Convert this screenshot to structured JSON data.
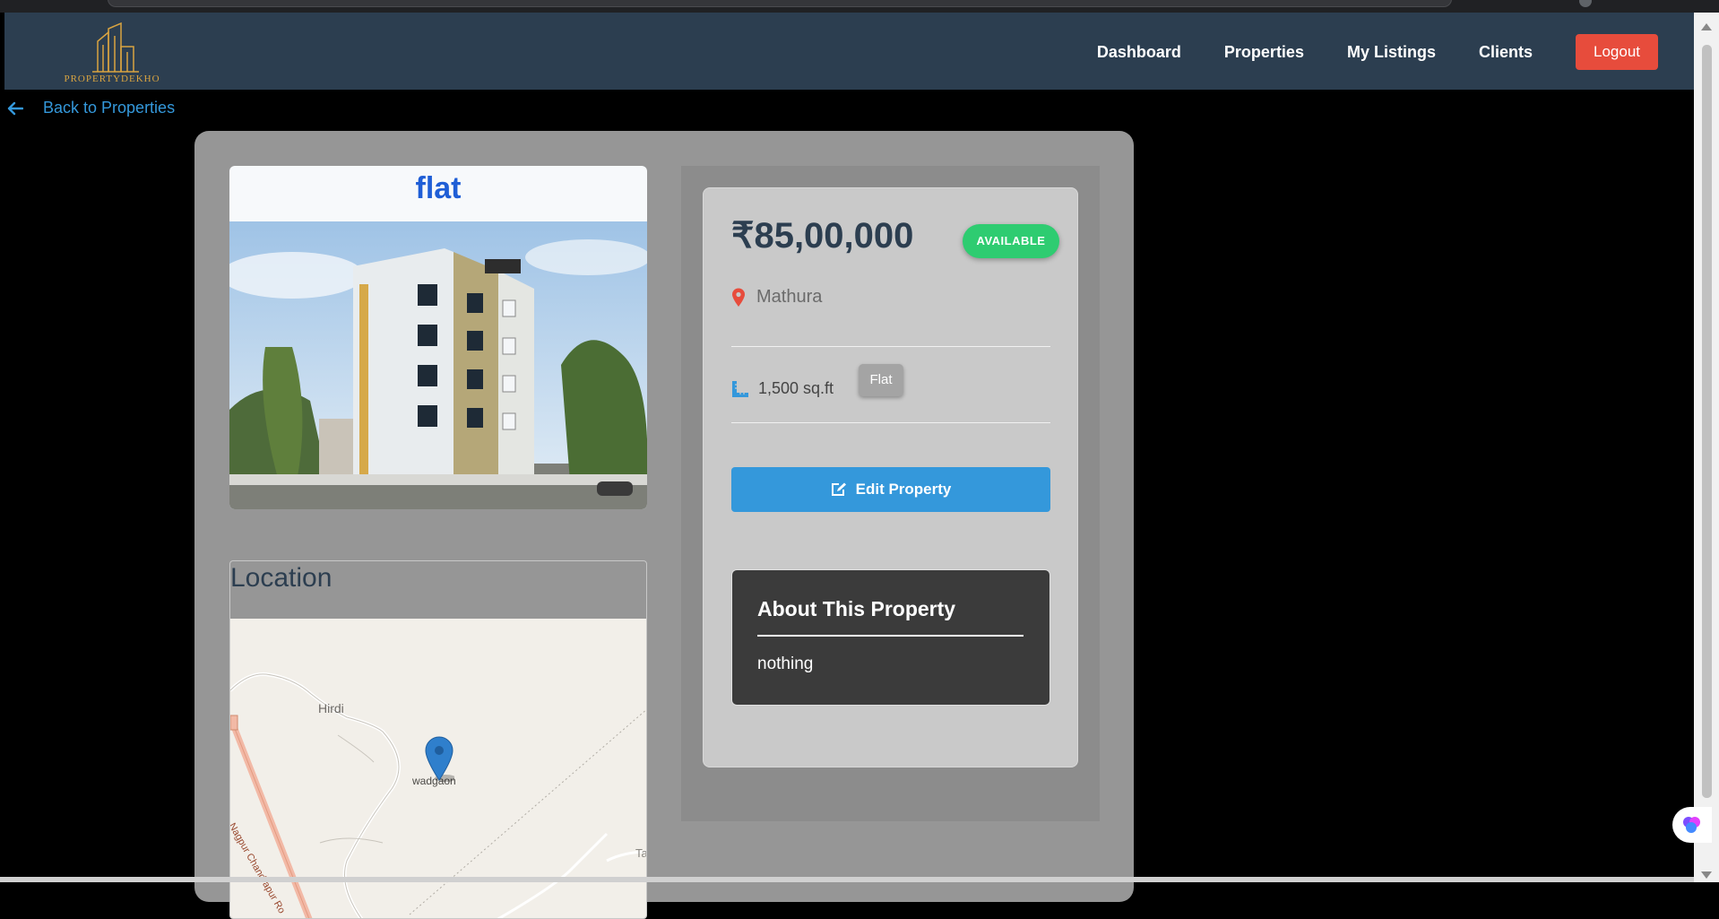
{
  "app": {
    "brand": "PROPERTYDEKHO"
  },
  "nav": {
    "items": [
      "Dashboard",
      "Properties",
      "My Listings",
      "Clients"
    ],
    "logout": "Logout"
  },
  "back": {
    "label": "Back to Properties"
  },
  "property": {
    "title": "flat",
    "price": "₹85,00,000",
    "status": "AVAILABLE",
    "location": "Mathura",
    "area": "1,500 sq.ft",
    "type": "Flat",
    "edit_label": "Edit Property",
    "about_title": "About This Property",
    "description": "nothing"
  },
  "location_section": {
    "title": "Location",
    "map_labels": {
      "place1": "Hirdi",
      "place2": "wadgaon",
      "road": "Nagpur Chandrapur Ro",
      "edge": "Ta"
    }
  },
  "colors": {
    "navbar": "#2c3e50",
    "logout": "#e74c3c",
    "accent": "#3498db",
    "available": "#2ecc71",
    "title": "#1f5ed6"
  },
  "icons": [
    "back-arrow-icon",
    "map-pin-icon",
    "ruler-icon",
    "edit-icon",
    "map-marker-icon"
  ]
}
